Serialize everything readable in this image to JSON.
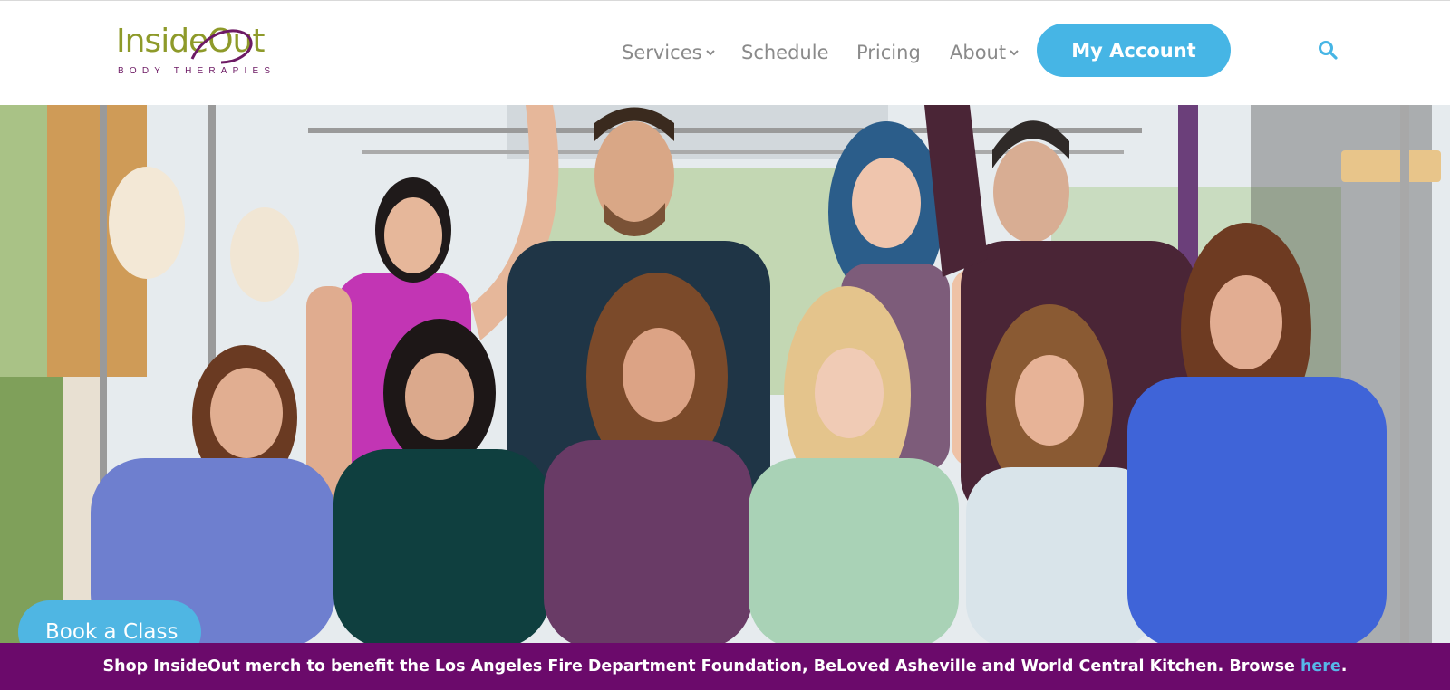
{
  "brand": {
    "logo_text": "InsideOut",
    "logo_subtext": "BODY THERAPIES",
    "logo_color": "#8e9a2a",
    "logo_sub_color": "#6d1a64"
  },
  "nav": {
    "items": [
      {
        "label": "Services",
        "has_dropdown": true
      },
      {
        "label": "Schedule",
        "has_dropdown": false
      },
      {
        "label": "Pricing",
        "has_dropdown": false
      },
      {
        "label": "About",
        "has_dropdown": true
      }
    ],
    "account_label": "My Account",
    "search_icon": "search-icon"
  },
  "hero": {
    "image": "studio-team-photo"
  },
  "cta": {
    "book_label": "Book a Class"
  },
  "banner": {
    "text": "Shop InsideOut merch to benefit the Los Angeles Fire Department Foundation, BeLoved Asheville and World Central Kitchen. Browse ",
    "link_label": "here",
    "after": "."
  },
  "colors": {
    "accent_blue": "#46b5e5",
    "banner_purple": "#6b0a6b",
    "nav_text": "#8a8a8a"
  }
}
